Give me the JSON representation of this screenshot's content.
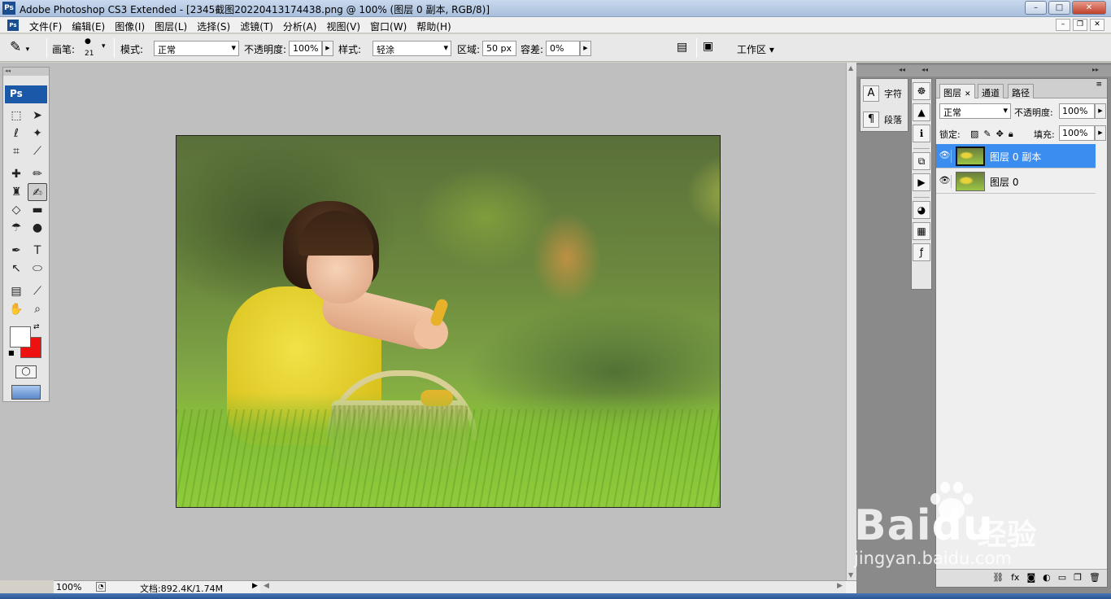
{
  "app": {
    "title": "Adobe Photoshop CS3 Extended - [2345截图20220413174438.png @ 100% (图层 0 副本, RGB/8)]",
    "ps_logo": "Ps",
    "window_buttons": {
      "minimize": "–",
      "maximize": "□",
      "close": "✕"
    }
  },
  "menu": [
    "文件(F)",
    "编辑(E)",
    "图像(I)",
    "图层(L)",
    "选择(S)",
    "滤镜(T)",
    "分析(A)",
    "视图(V)",
    "窗口(W)",
    "帮助(H)"
  ],
  "mdi_buttons": {
    "minimize": "–",
    "restore": "❐",
    "close": "✕"
  },
  "options": {
    "tool_icon": "smudge-tool-icon",
    "brush_label": "画笔:",
    "brush_size": "21",
    "mode_label": "模式:",
    "mode_value": "正常",
    "opacity_label": "不透明度:",
    "opacity_value": "100%",
    "style_label": "样式:",
    "style_value": "轻涂",
    "area_label": "区域:",
    "area_value": "50 px",
    "tolerance_label": "容差:",
    "tolerance_value": "0%",
    "workspace_label": "工作区 ▾"
  },
  "toolbox": {
    "header": "Ps",
    "fg_color": "#ffffff",
    "bg_color": "#ee1111"
  },
  "status": {
    "zoom": "100%",
    "doc": "文档:892.4K/1.74M"
  },
  "mini_dock": {
    "char_label": "字符",
    "para_label": "段落"
  },
  "layers_panel": {
    "tabs": [
      "图层",
      "通道",
      "路径"
    ],
    "blend_mode": "正常",
    "opacity_label": "不透明度:",
    "opacity_value": "100%",
    "lock_label": "锁定:",
    "fill_label": "填充:",
    "fill_value": "100%",
    "layers": [
      {
        "name": "图层 0 副本",
        "selected": true
      },
      {
        "name": "图层 0",
        "selected": false
      }
    ],
    "selection_color": "#3b8ef0"
  },
  "watermark": {
    "brand": "Bai",
    "brand_tail": "du",
    "brand_cn": "经验",
    "site": "jingyan.baidu.com"
  }
}
